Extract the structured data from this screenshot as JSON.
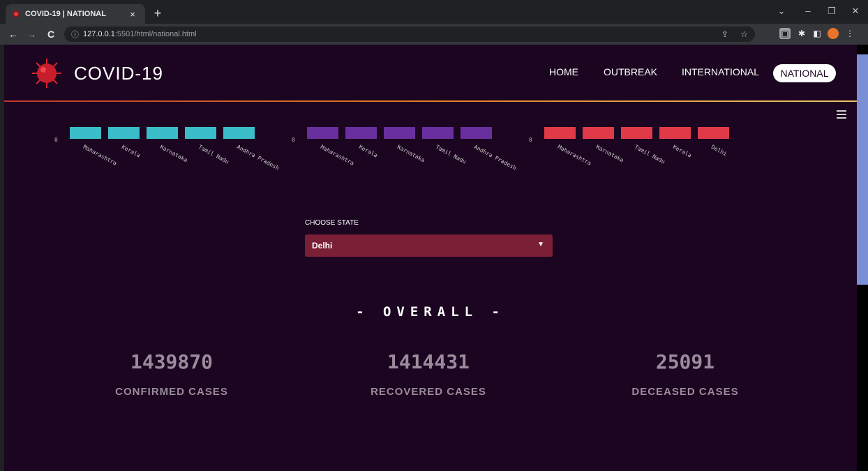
{
  "browser": {
    "tab_title": "COVID-19 | NATIONAL",
    "tab_close": "×",
    "new_tab": "+",
    "url_host": "127.0.0.1",
    "url_path": ":5501/html/national.html",
    "back": "←",
    "forward": "→",
    "reload": "C",
    "info": "ⓘ",
    "share": "⇪",
    "bookmark": "☆"
  },
  "nav": {
    "brand": "COVID-19",
    "items": [
      "HOME",
      "OUTBREAK",
      "INTERNATIONAL"
    ],
    "active": "NATIONAL"
  },
  "chart_data": [
    {
      "type": "bar",
      "categories": [
        "Maharashtra",
        "Kerala",
        "Karnataka",
        "Tamil Nadu",
        "Andhra Pradesh"
      ],
      "y_tick": "0",
      "color": "#3bbcc9"
    },
    {
      "type": "bar",
      "categories": [
        "Maharashtra",
        "Kerala",
        "Karnataka",
        "Tamil Nadu",
        "Andhra Pradesh"
      ],
      "y_tick": "0",
      "color": "#6a2f9e"
    },
    {
      "type": "bar",
      "categories": [
        "Maharashtra",
        "Karnataka",
        "Tamil Nadu",
        "Kerala",
        "Delhi"
      ],
      "y_tick": "0",
      "color": "#e03a48"
    }
  ],
  "state_select": {
    "label": "CHOOSE STATE",
    "value": "Delhi"
  },
  "overall": {
    "title": "- OVERALL -",
    "confirmed": "1439870",
    "confirmed_label": "CONFIRMED CASES",
    "recovered": "1414431",
    "recovered_label": "RECOVERED CASES",
    "deceased": "25091",
    "deceased_label": "DECEASED CASES"
  }
}
